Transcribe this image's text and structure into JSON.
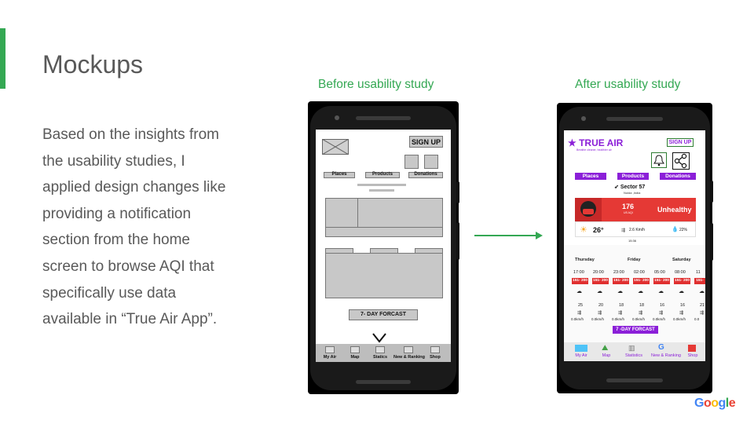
{
  "colors": {
    "accent": "#34a853",
    "label": "#34a853",
    "purple": "#8b1fd8",
    "red": "#e53935"
  },
  "title": "Mockups",
  "body_lines": [
    "Based on the insights from",
    "the usability studies, I",
    "applied design changes like",
    "providing a notification",
    "section from the home",
    "screen to browse AQI that",
    "specifically use data",
    "available in “True Air App”."
  ],
  "label_before": "Before usability study",
  "label_after": "After usability study",
  "before": {
    "signup": "SIGN UP",
    "tabs": [
      "Places",
      "Products",
      "Donations"
    ],
    "forecast": "7- DAY FORCAST",
    "nav": [
      "My Air",
      "Map",
      "Statics",
      "New & Ranking",
      "Shop"
    ]
  },
  "after": {
    "brand": "TRUE AIR",
    "tagline": "Breathe cleaner, healthier air",
    "signup": "SIGN UP",
    "tabs": [
      "Places",
      "Products",
      "Donations"
    ],
    "location": "Sector 57",
    "location_sub": "Noida ,India",
    "aqi": "176",
    "aqi_unit": "US AQI",
    "status": "Unhealthy",
    "temp": "26",
    "wind": "2.6 Km/h",
    "humidity": "22%",
    "updated": "15:36",
    "days": [
      "Thursday",
      "Friday",
      "Saturday"
    ],
    "times": [
      "17:00",
      "20:00",
      "23:00",
      "02:00",
      "05:00",
      "08:00",
      "11"
    ],
    "ranges": [
      "151- 200",
      "151- 200",
      "151- 200",
      "151- 200",
      "151- 200",
      "151- 200",
      "151-"
    ],
    "temps": [
      "25",
      "20",
      "18",
      "18",
      "16",
      "16",
      "21"
    ],
    "winds": [
      "0.0km/h",
      "0.0km/h",
      "0.0km/h",
      "0.0km/h",
      "0.0km/h",
      "0.0km/h",
      "0.0"
    ],
    "forecast": "7 -DAY FORCAST",
    "nav": [
      "My Air",
      "Map",
      "Statistics",
      "New & Ranking",
      "Shop"
    ]
  },
  "google": "Google"
}
